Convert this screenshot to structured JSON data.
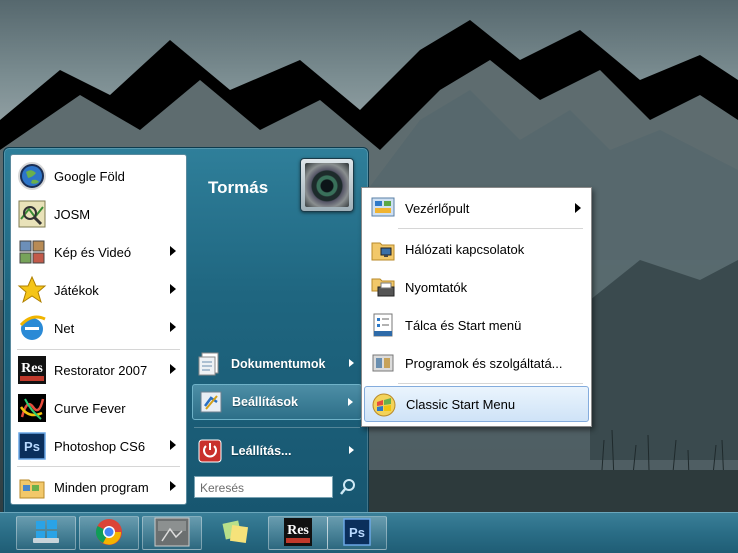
{
  "start_menu": {
    "user_name": "Tormás",
    "left_items": [
      {
        "label": "Google Föld",
        "icon": "google-earth-icon"
      },
      {
        "label": "JOSM",
        "icon": "josm-icon"
      },
      {
        "label": "Kép és Videó",
        "icon": "pictures-icon",
        "has_submenu": true
      },
      {
        "label": "Játékok",
        "icon": "star-icon",
        "has_submenu": true
      },
      {
        "label": "Net",
        "icon": "internet-explorer-icon",
        "has_submenu": true
      },
      {
        "label": "Restorator 2007",
        "icon": "restorator-icon",
        "has_submenu": true
      },
      {
        "label": "Curve Fever",
        "icon": "curve-fever-icon"
      },
      {
        "label": "Photoshop CS6",
        "icon": "photoshop-icon",
        "has_submenu": true
      },
      {
        "label": "Minden program",
        "icon": "programs-folder-icon",
        "has_submenu": true
      }
    ],
    "right_items": [
      {
        "label": "Dokumentumok",
        "icon": "documents-icon",
        "has_submenu": true
      },
      {
        "label": "Beállítások",
        "icon": "settings-icon",
        "has_submenu": true,
        "highlighted": true
      },
      {
        "label": "Leállítás...",
        "icon": "shutdown-icon",
        "has_submenu": true
      }
    ],
    "search_placeholder": "Keresés"
  },
  "settings_submenu": {
    "items": [
      {
        "label": "Vezérlőpult",
        "icon": "control-panel-icon",
        "has_submenu": true
      },
      {
        "label": "Hálózati kapcsolatok",
        "icon": "network-connections-icon"
      },
      {
        "label": "Nyomtatók",
        "icon": "printers-icon"
      },
      {
        "label": "Tálca és Start menü",
        "icon": "taskbar-icon"
      },
      {
        "label": "Programok és szolgáltatá...",
        "icon": "programs-features-icon"
      },
      {
        "label": "Classic Start Menu",
        "icon": "classic-start-menu-icon",
        "highlighted": true
      }
    ]
  },
  "taskbar": {
    "buttons": [
      {
        "name": "start-button",
        "icon": "windows-logo-icon"
      },
      {
        "name": "chrome",
        "icon": "chrome-icon"
      },
      {
        "name": "desktop-window",
        "icon": "window-thumbnail-icon"
      },
      {
        "name": "sticky-notes",
        "icon": "sticky-notes-icon"
      },
      {
        "name": "restorator",
        "icon": "restorator-icon"
      },
      {
        "name": "photoshop",
        "icon": "photoshop-icon"
      }
    ]
  },
  "colors": {
    "menu_accent": "#1f6680",
    "submenu_highlight": "#cfe3f7",
    "taskbar": "#2a6d86"
  }
}
